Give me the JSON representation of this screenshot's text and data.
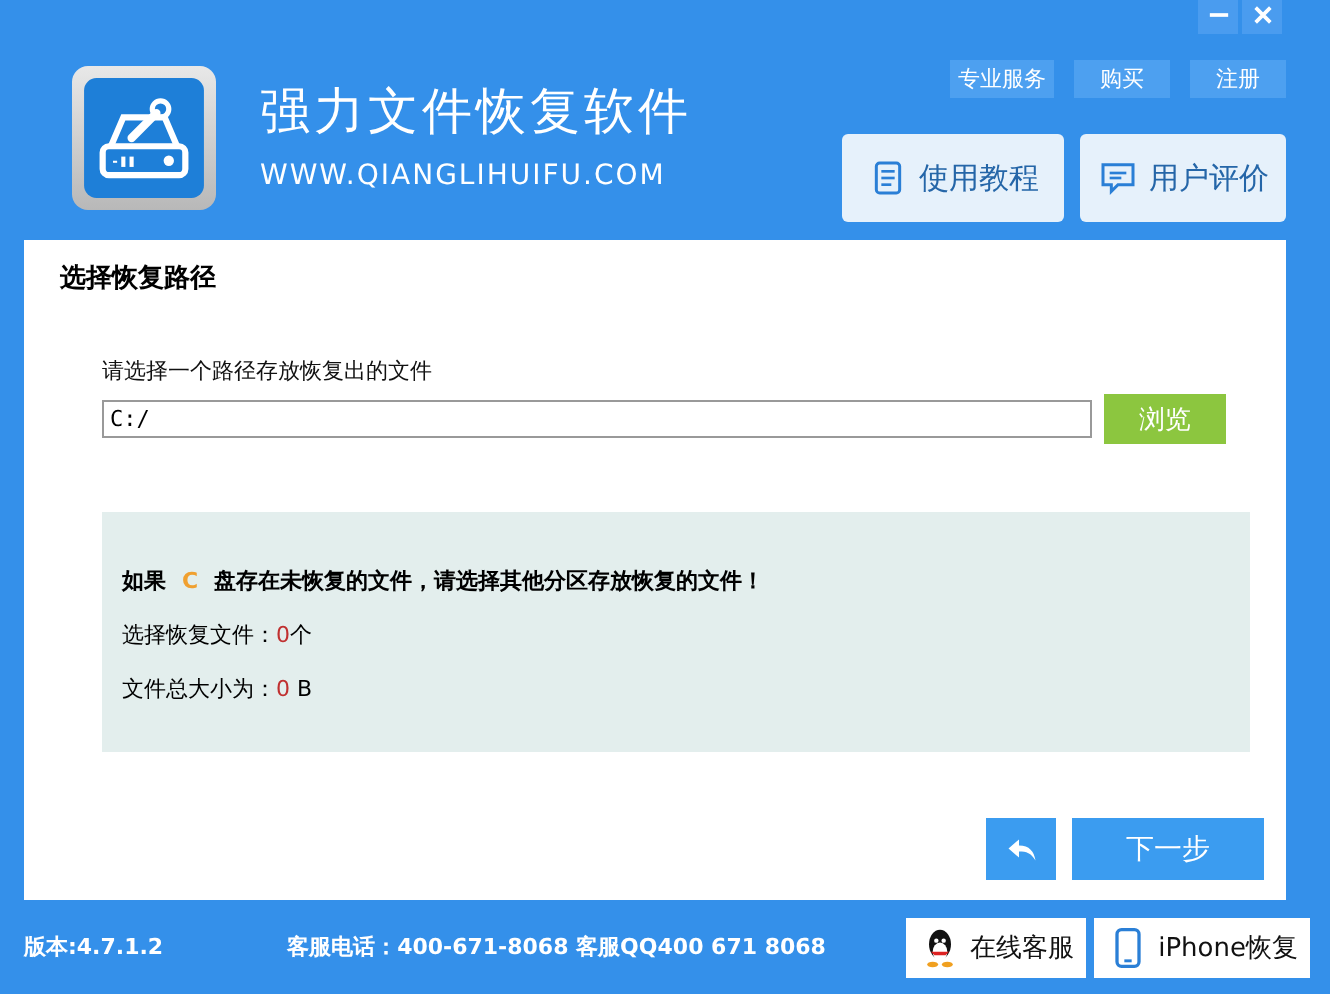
{
  "window": {
    "title": "强力文件恢复软件",
    "subtitle": "WWW.QIANGLIHUIFU.COM"
  },
  "top_links": [
    "专业服务",
    "购买",
    "注册"
  ],
  "header_buttons": [
    {
      "label": "使用教程",
      "kind": "doc"
    },
    {
      "label": "用户评价",
      "kind": "chat"
    }
  ],
  "panel": {
    "heading": "选择恢复路径",
    "path_label": "请选择一个路径存放恢复出的文件",
    "path": {
      "value": "C:/"
    },
    "browse_button": "浏览",
    "warning": {
      "prefix": "如果",
      "drive": "C",
      "suffix": "盘存在未恢复的文件，请选择其他分区存放恢复的文件！"
    },
    "stats": [
      {
        "label": "选择恢复文件：",
        "value": "0",
        "unit": "个"
      },
      {
        "label": "文件总大小为：",
        "value": "0",
        "unit": " B"
      }
    ],
    "next_button": "下一步"
  },
  "status_bar": {
    "version": "版本:4.7.1.2",
    "contact": "客服电话：400-671-8068 客服QQ400 671 8068",
    "buttons": [
      {
        "label": "在线客服",
        "kind": "qq"
      },
      {
        "label": "iPhone恢复",
        "kind": "phone"
      }
    ]
  }
}
